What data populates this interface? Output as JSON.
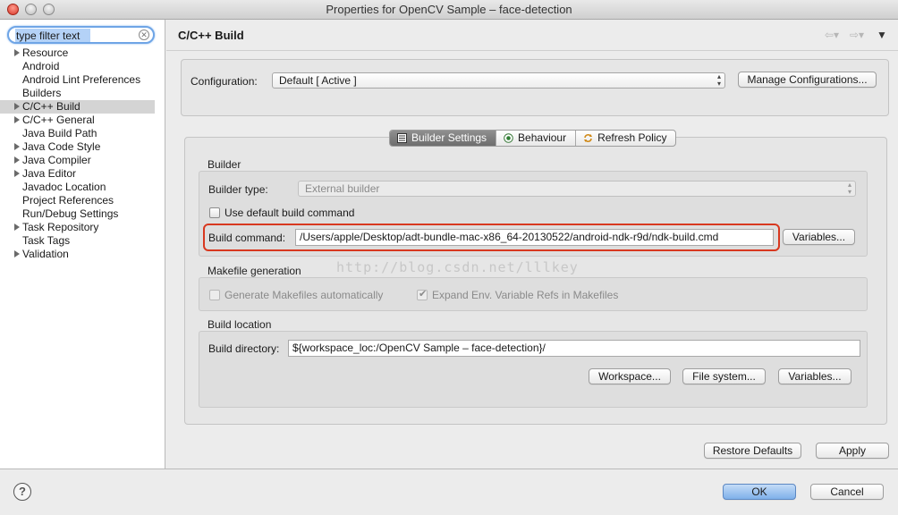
{
  "window": {
    "title": "Properties for OpenCV Sample – face-detection"
  },
  "filter": {
    "placeholder": "type filter text",
    "value": "type filter text"
  },
  "tree": [
    {
      "label": "Resource",
      "expandable": true
    },
    {
      "label": "Android",
      "expandable": false
    },
    {
      "label": "Android Lint Preferences",
      "expandable": false
    },
    {
      "label": "Builders",
      "expandable": false
    },
    {
      "label": "C/C++ Build",
      "expandable": true,
      "selected": true
    },
    {
      "label": "C/C++ General",
      "expandable": true
    },
    {
      "label": "Java Build Path",
      "expandable": false
    },
    {
      "label": "Java Code Style",
      "expandable": true
    },
    {
      "label": "Java Compiler",
      "expandable": true
    },
    {
      "label": "Java Editor",
      "expandable": true
    },
    {
      "label": "Javadoc Location",
      "expandable": false
    },
    {
      "label": "Project References",
      "expandable": false
    },
    {
      "label": "Run/Debug Settings",
      "expandable": false
    },
    {
      "label": "Task Repository",
      "expandable": true
    },
    {
      "label": "Task Tags",
      "expandable": false
    },
    {
      "label": "Validation",
      "expandable": true
    }
  ],
  "page": {
    "title": "C/C++ Build"
  },
  "configuration": {
    "label": "Configuration:",
    "value": "Default  [ Active ]",
    "manage_label": "Manage Configurations..."
  },
  "tabs": [
    {
      "label": "Builder Settings",
      "icon": "list-icon",
      "active": true
    },
    {
      "label": "Behaviour",
      "icon": "radio-icon",
      "active": false
    },
    {
      "label": "Refresh Policy",
      "icon": "refresh-icon",
      "active": false
    }
  ],
  "builder": {
    "group_label": "Builder",
    "type_label": "Builder type:",
    "type_value": "External builder",
    "use_default_label": "Use default build command",
    "use_default_checked": false,
    "command_label": "Build command:",
    "command_value": "/Users/apple/Desktop/adt-bundle-mac-x86_64-20130522/android-ndk-r9d/ndk-build.cmd",
    "variables_label": "Variables..."
  },
  "makefile": {
    "group_label": "Makefile generation",
    "generate_label": "Generate Makefiles automatically",
    "generate_checked": false,
    "expand_label": "Expand Env. Variable Refs in Makefiles",
    "expand_checked": true
  },
  "location": {
    "group_label": "Build location",
    "dir_label": "Build directory:",
    "dir_value": "${workspace_loc:/OpenCV Sample – face-detection}/",
    "workspace_label": "Workspace...",
    "filesystem_label": "File system...",
    "variables_label": "Variables..."
  },
  "watermark": "http://blog.csdn.net/lllkey",
  "footer": {
    "restore_label": "Restore Defaults",
    "apply_label": "Apply",
    "ok_label": "OK",
    "cancel_label": "Cancel",
    "help_glyph": "?"
  },
  "colors": {
    "highlight_ring": "#d8381f",
    "ok_button": "#7fb0ea",
    "filter_focus": "#6fa5e6"
  }
}
